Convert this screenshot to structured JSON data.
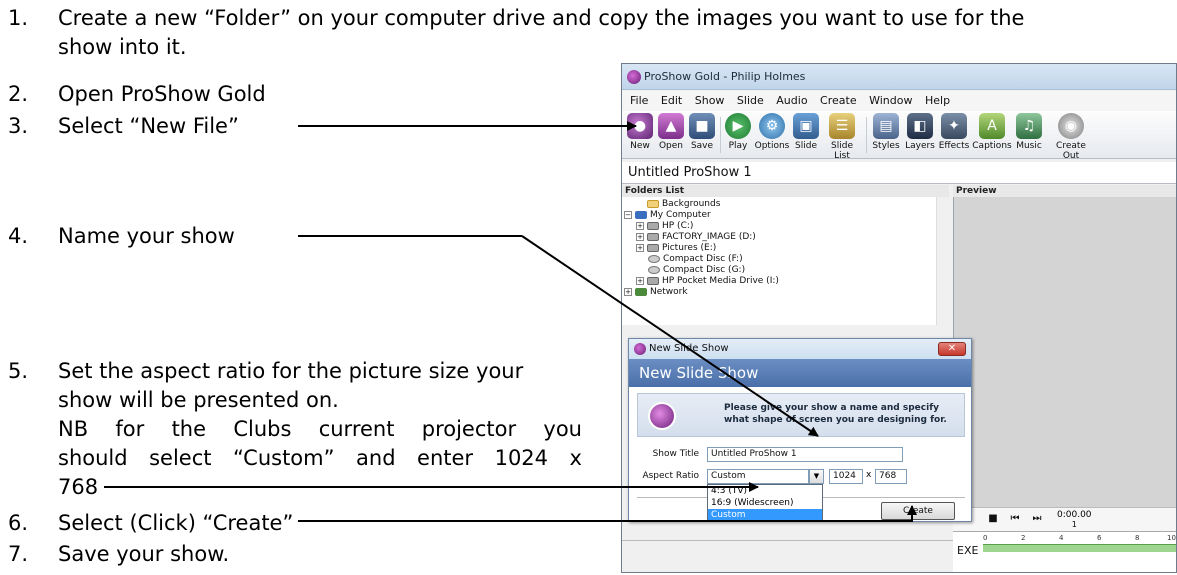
{
  "steps": [
    {
      "num": "1.",
      "lines": [
        "Create a new “Folder” on your computer drive and copy the images you want to use for the",
        "show into it."
      ]
    },
    {
      "num": "2.",
      "lines": [
        "Open ProShow Gold"
      ]
    },
    {
      "num": "3.",
      "lines": [
        "Select “New File”"
      ]
    },
    {
      "num": "4.",
      "lines": [
        "Name your show"
      ]
    },
    {
      "num": "5.",
      "lines": [
        "Set the aspect ratio for the picture size your",
        "show will be presented on.",
        "NB for the Clubs current projector you",
        "should select “Custom” and enter 1024 x",
        "768"
      ]
    },
    {
      "num": "6.",
      "lines": [
        "Select (Click) “Create”"
      ]
    },
    {
      "num": "7.",
      "lines": [
        "Save your show."
      ]
    }
  ],
  "app": {
    "title": "ProShow Gold - Philip Holmes",
    "menu": [
      "File",
      "Edit",
      "Show",
      "Slide",
      "Audio",
      "Create",
      "Window",
      "Help"
    ],
    "toolbar": [
      "New",
      "Open",
      "Save",
      "Play",
      "Options",
      "Slide",
      "Slide List",
      "Styles",
      "Layers",
      "Effects",
      "Captions",
      "Music",
      "Create Out"
    ],
    "show_title": "Untitled ProShow 1",
    "folders_header": "Folders List",
    "preview_header": "Preview",
    "folders": [
      "Backgrounds",
      "My Computer",
      "HP (C:)",
      "FACTORY_IMAGE (D:)",
      "Pictures (E:)",
      "Compact Disc (F:)",
      "Compact Disc (G:)",
      "HP Pocket Media Drive (I:)",
      "Network"
    ],
    "time": "0:00.00",
    "time_sub": "1",
    "exe": "EXE",
    "ruler": [
      "0",
      "2",
      "4",
      "6",
      "8",
      "10"
    ]
  },
  "dialog": {
    "window_title": "New Slide Show",
    "heading": "New Slide Show",
    "info_line1": "Please give your show a name and specify",
    "info_line2": "what shape of screen you are designing for.",
    "show_title_label": "Show Title",
    "show_title_value": "Untitled ProShow 1",
    "aspect_label": "Aspect Ratio",
    "aspect_value": "Custom",
    "width": "1024",
    "x": "x",
    "height": "768",
    "options": [
      "4:3 (TV)",
      "16:9 (Widescreen)",
      "Custom"
    ],
    "create": "Create"
  },
  "colors": {
    "accent": "#4a6ea8",
    "selected": "#3399ff"
  }
}
